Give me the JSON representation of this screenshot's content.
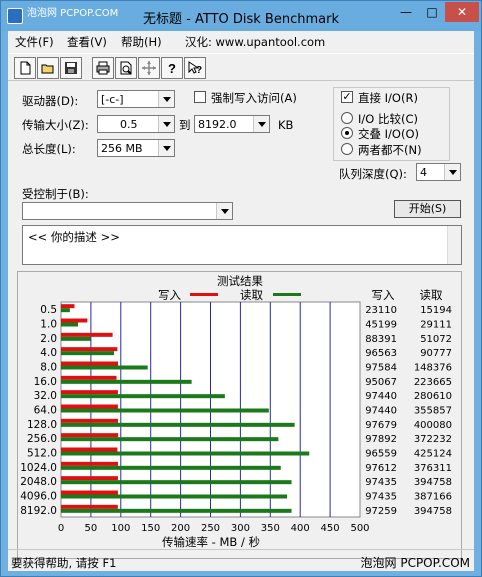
{
  "window": {
    "title": "无标题 - ATTO Disk Benchmark",
    "watermark_top": "泡泡网 PCPOP.COM",
    "min_glyph": "—",
    "max_glyph": "□",
    "close_glyph": "✕"
  },
  "menu": {
    "file": "文件(F)",
    "view": "查看(V)",
    "help": "帮助(H)",
    "credit": "汉化: www.upantool.com"
  },
  "toolbar": {
    "icons": [
      "new-file-icon",
      "open-folder-icon",
      "save-icon",
      "print-icon",
      "print-preview-icon",
      "move-icon",
      "help-icon",
      "context-help-icon"
    ]
  },
  "settings": {
    "drive_label": "驱动器(D):",
    "drive_value": "[-c-]",
    "force_write_label": "强制写入访问(A)",
    "force_write_checked": false,
    "transfer_label": "传输大小(Z):",
    "transfer_from": "0.5",
    "transfer_to_label": "到",
    "transfer_to": "8192.0",
    "transfer_unit": "KB",
    "total_label": "总长度(L):",
    "total_value": "256 MB",
    "controlled_by_label": "受控制于(B):",
    "controlled_by_value": "",
    "direct_io_label": "直接 I/O(R)",
    "direct_io_checked": true,
    "io_compare_label": "I/O 比较(C)",
    "overlapped_io_label": "交叠 I/O(O)",
    "neither_label": "两者都不(N)",
    "selected_io_mode": "overlapped",
    "queue_label": "队列深度(Q):",
    "queue_value": "4",
    "start_label": "开始(S)",
    "description": "<<   你的描述   >>"
  },
  "chart_data": {
    "type": "bar",
    "title": "测试结果",
    "legend": [
      {
        "name": "写入",
        "color": "#e01010"
      },
      {
        "name": "读取",
        "color": "#1a7a1a"
      }
    ],
    "xlabel": "传输速率 - MB / 秒",
    "xlim": [
      0,
      500
    ],
    "xticks": [
      0,
      50,
      100,
      150,
      200,
      250,
      300,
      350,
      400,
      450,
      500
    ],
    "categories": [
      "0.5",
      "1.0",
      "2.0",
      "4.0",
      "8.0",
      "16.0",
      "32.0",
      "64.0",
      "128.0",
      "256.0",
      "512.0",
      "1024.0",
      "2048.0",
      "4096.0",
      "8192.0"
    ],
    "columns": [
      "写入",
      "读取"
    ],
    "write_kbs": [
      23110,
      45199,
      88391,
      96563,
      97584,
      95067,
      97440,
      97440,
      97679,
      97892,
      96559,
      97612,
      97435,
      97435,
      97259
    ],
    "read_kbs": [
      15194,
      29111,
      51072,
      90777,
      148376,
      223665,
      280610,
      355857,
      400080,
      372232,
      425124,
      376311,
      394758,
      387166,
      394758
    ],
    "grid": true
  },
  "status": {
    "text": "要获得帮助, 请按 F1",
    "watermark_bottom": "泡泡网 PCPOP.COM"
  }
}
